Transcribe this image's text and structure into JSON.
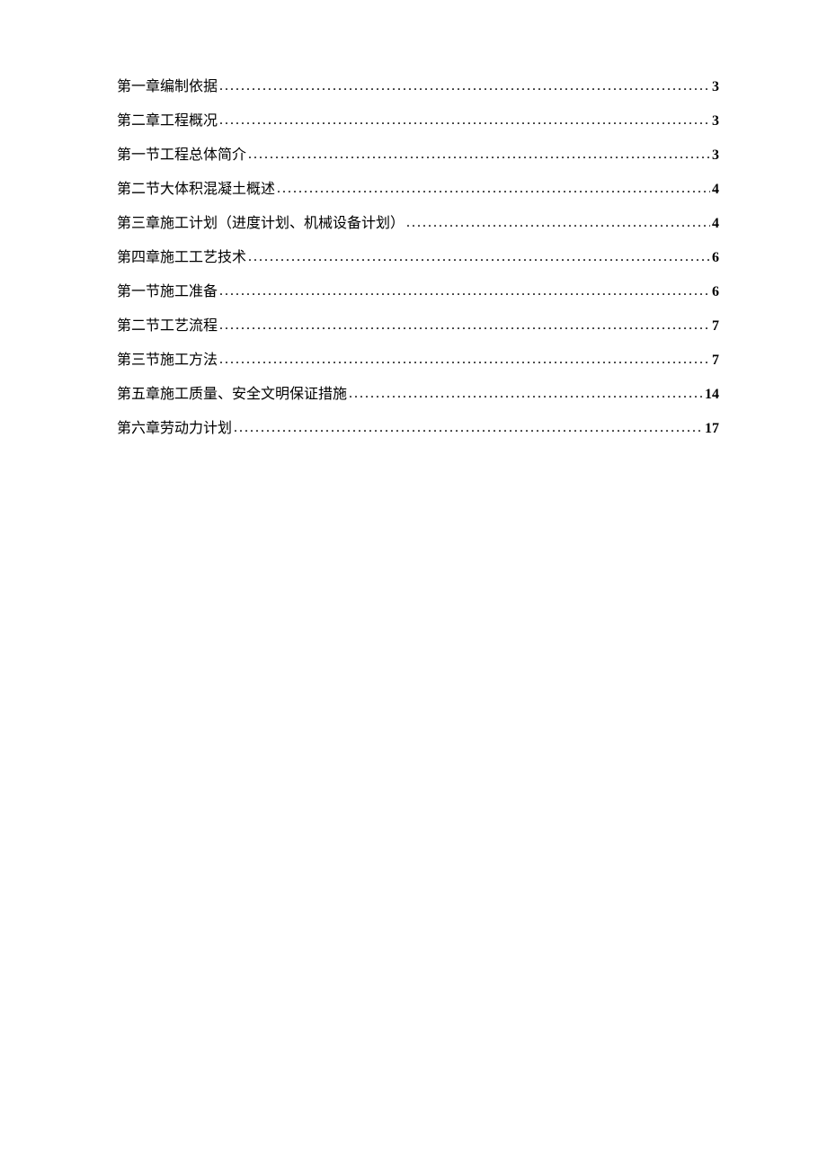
{
  "toc": {
    "entries": [
      {
        "title": "第一章编制依据",
        "page": "3"
      },
      {
        "title": "第二章工程概况",
        "page": "3"
      },
      {
        "title": "第一节工程总体简介",
        "page": "3"
      },
      {
        "title": "第二节大体积混凝土概述",
        "page": "4"
      },
      {
        "title": "第三章施工计划（进度计划、机械设备计划）",
        "page": "4"
      },
      {
        "title": "第四章施工工艺技术",
        "page": "6"
      },
      {
        "title": "第一节施工准备",
        "page": "6"
      },
      {
        "title": "第二节工艺流程",
        "page": "7"
      },
      {
        "title": "第三节施工方法",
        "page": "7"
      },
      {
        "title": "第五章施工质量、安全文明保证措施",
        "page": "14"
      },
      {
        "title": "第六章劳动力计划",
        "page": "17"
      }
    ]
  }
}
